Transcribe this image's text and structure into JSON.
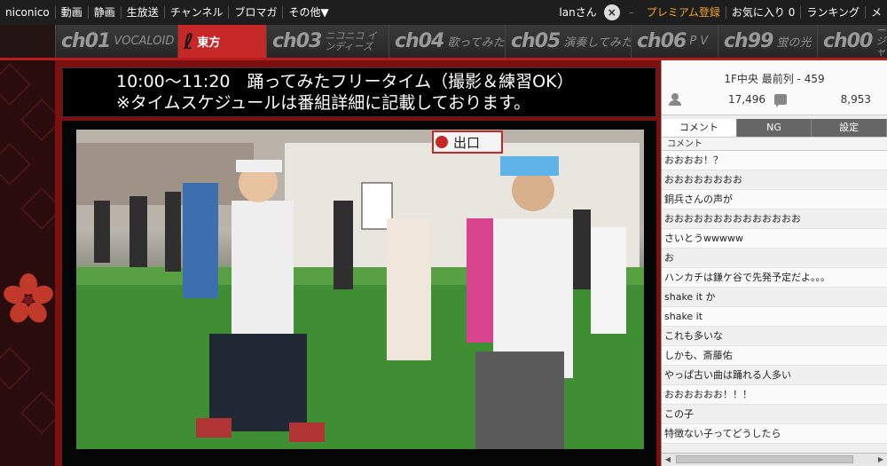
{
  "topnav": {
    "left_items": [
      "niconico",
      "動画",
      "静画",
      "生放送",
      "チャンネル",
      "ブロマガ",
      "その他▼"
    ],
    "user": "lanさん",
    "close_icon": "close-icon",
    "premium": "プレミアム登録",
    "favorites": "お気に入り 0",
    "ranking": "ランキング",
    "mail": "メ"
  },
  "channels": [
    {
      "num": "ch01",
      "name": "VOCALOID",
      "active": false
    },
    {
      "num": "",
      "name": "東方",
      "active": true
    },
    {
      "num": "ch03",
      "name": "ニコニコ インディーズ",
      "active": false
    },
    {
      "num": "ch04",
      "name": "歌ってみた",
      "active": false
    },
    {
      "num": "ch05",
      "name": "演奏してみた",
      "active": false
    },
    {
      "num": "ch06",
      "name": "P V",
      "active": false
    },
    {
      "num": "ch99",
      "name": "蛍の光",
      "active": false
    },
    {
      "num": "ch00",
      "name": "オー ジャン",
      "active": false
    }
  ],
  "banner": {
    "line1": "10:00〜11:20　踊ってみたフリータイム（撮影＆練習OK）",
    "line2": "※タイムスケジュールは番組詳細に記載しております。"
  },
  "video": {
    "sign_text": "出口"
  },
  "panel": {
    "room": "1F中央 最前列 - 459",
    "viewers": "17,496",
    "comments_count": "8,953",
    "tabs": [
      "コメント",
      "NG",
      "設定"
    ],
    "column_header": "コメント",
    "comments": [
      "おおおお！？",
      "おおおおおおおお",
      "銅兵さんの声が",
      "おおおおおおおおおおおおおお",
      "さいとうwwwww",
      "お",
      "ハンカチは鎌ケ谷で先発予定だよ。。。",
      "shake it か",
      "shake it",
      "これも多いな",
      "しかも、斎藤佑",
      "やっぱ古い曲は踊れる人多い",
      "おおおおおお！！！",
      "この子",
      "特徴ない子ってどうしたら"
    ]
  },
  "colors": {
    "accent_red": "#c62828",
    "premium": "#f5a623"
  }
}
